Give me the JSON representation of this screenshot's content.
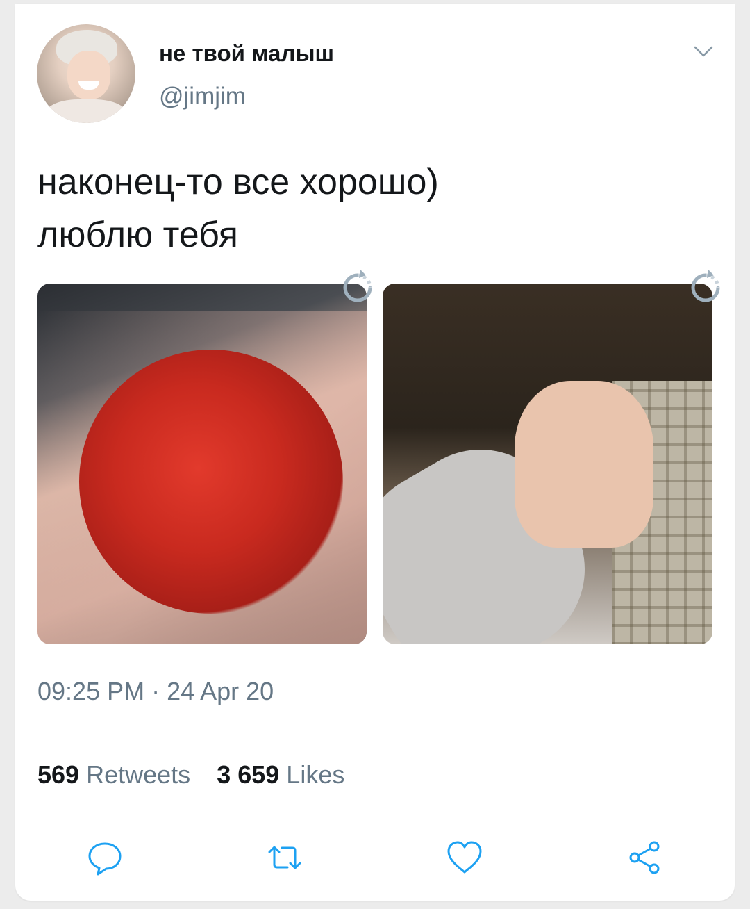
{
  "tweet": {
    "display_name": "не твой малыш",
    "handle": "@jimjim",
    "text": "наконец-то все хорошо)\nлюблю тебя",
    "timestamp": "09:25 PM · 24 Apr 20",
    "stats": {
      "retweets_count": "569",
      "retweets_label": "Retweets",
      "likes_count": "3 659",
      "likes_label": "Likes"
    },
    "media": [
      {
        "kind": "photo",
        "subject": "red rose bouquet"
      },
      {
        "kind": "photo",
        "subject": "holding hands"
      }
    ],
    "actions": [
      "reply-icon",
      "retweet-icon",
      "like-icon",
      "share-icon"
    ]
  },
  "colors": {
    "text_primary": "#14171a",
    "text_secondary": "#657786",
    "divider": "#e1e8ed",
    "icon": "#1da1f2"
  }
}
